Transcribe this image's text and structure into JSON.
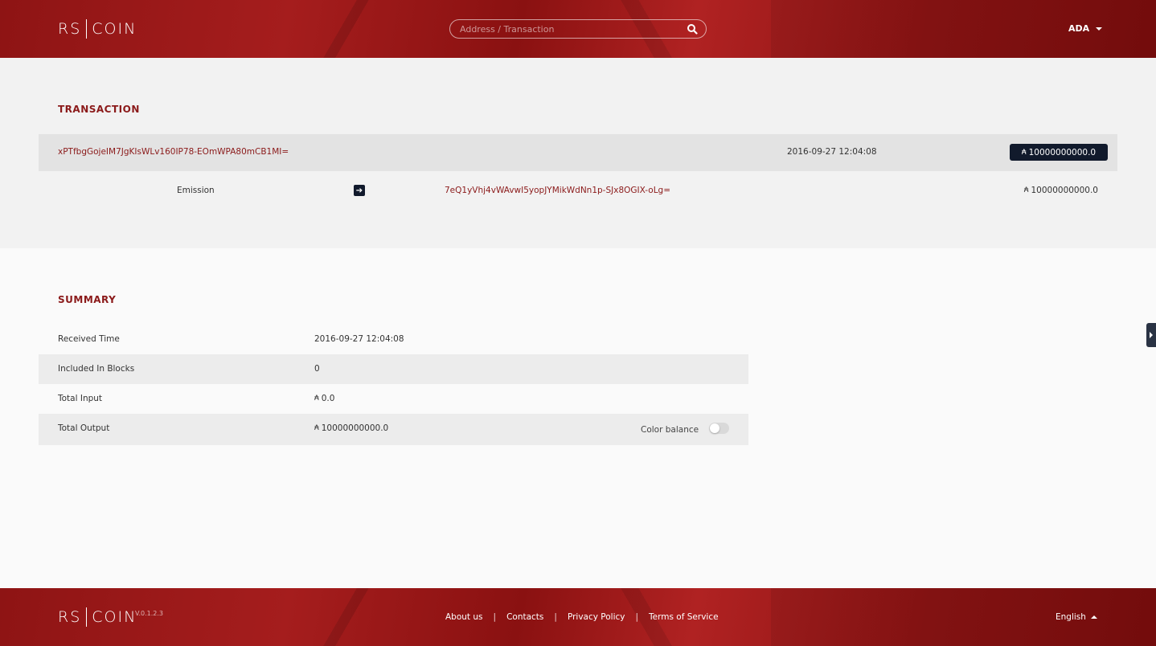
{
  "header": {
    "logo_left": "RS",
    "logo_right": "COIN",
    "search_placeholder": "Address / Transaction",
    "currency": "ADA"
  },
  "transaction": {
    "title": "TRANSACTION",
    "hash": "xPTfbgGojeIM7JgKIsWLv160IP78-EOmWPA80mCB1MI=",
    "date": "2016-09-27 12:04:08",
    "amount": "10000000000.0",
    "input_label": "Emission",
    "output_address": "7eQ1yVhj4vWAvwI5yopJYMikWdNn1p-SJx8OGIX-oLg=",
    "output_amount": "10000000000.0"
  },
  "summary": {
    "title": "SUMMARY",
    "rows": [
      {
        "label": "Received Time",
        "value": "2016-09-27 12:04:08"
      },
      {
        "label": "Included In Blocks",
        "value": "0"
      },
      {
        "label": "Total Input",
        "value": "0.0"
      },
      {
        "label": "Total Output",
        "value": "10000000000.0"
      }
    ],
    "color_balance_label": "Color balance"
  },
  "footer": {
    "logo_left": "RS",
    "logo_right": "COIN",
    "version": "V.0.1.2.3",
    "links": [
      "About us",
      "Contacts",
      "Privacy Policy",
      "Terms of Service"
    ],
    "separator": "|",
    "language": "English"
  },
  "ada_symbol": "₳",
  "colors": {
    "brand_red": "#8b1a1a",
    "badge_dark": "#111a2c"
  }
}
